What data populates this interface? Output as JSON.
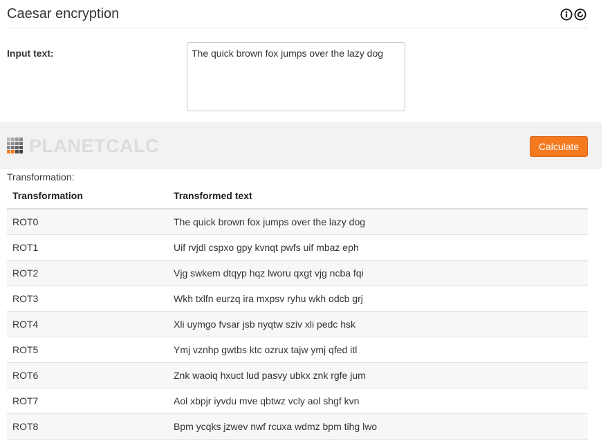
{
  "page": {
    "title": "Caesar encryption",
    "icons": [
      "info-icon",
      "reset-icon"
    ]
  },
  "input": {
    "label": "Input text:",
    "value": "The quick brown fox jumps over the lazy dog"
  },
  "brand": {
    "name": "PLANETCALC",
    "calculate_label": "Calculate",
    "accent_color": "#f47a20"
  },
  "result": {
    "caption": "Transformation:",
    "columns": [
      "Transformation",
      "Transformed text"
    ],
    "rows": [
      [
        "ROT0",
        "The quick brown fox jumps over the lazy dog"
      ],
      [
        "ROT1",
        "Uif rvjdl cspxo gpy kvnqt pwfs uif mbaz eph"
      ],
      [
        "ROT2",
        "Vjg swkem dtqyp hqz lworu qxgt vjg ncba fqi"
      ],
      [
        "ROT3",
        "Wkh txlfn eurzq ira mxpsv ryhu wkh odcb grj"
      ],
      [
        "ROT4",
        "Xli uymgo fvsar jsb nyqtw sziv xli pedc hsk"
      ],
      [
        "ROT5",
        "Ymj vznhp gwtbs ktc ozrux tajw ymj qfed itl"
      ],
      [
        "ROT6",
        "Znk waoiq hxuct lud pasvy ubkx znk rgfe jum"
      ],
      [
        "ROT7",
        "Aol xbpjr iyvdu mve qbtwz vcly aol shgf kvn"
      ],
      [
        "ROT8",
        "Bpm ycqks jzwev nwf rcuxa wdmz bpm tihg lwo"
      ]
    ]
  }
}
